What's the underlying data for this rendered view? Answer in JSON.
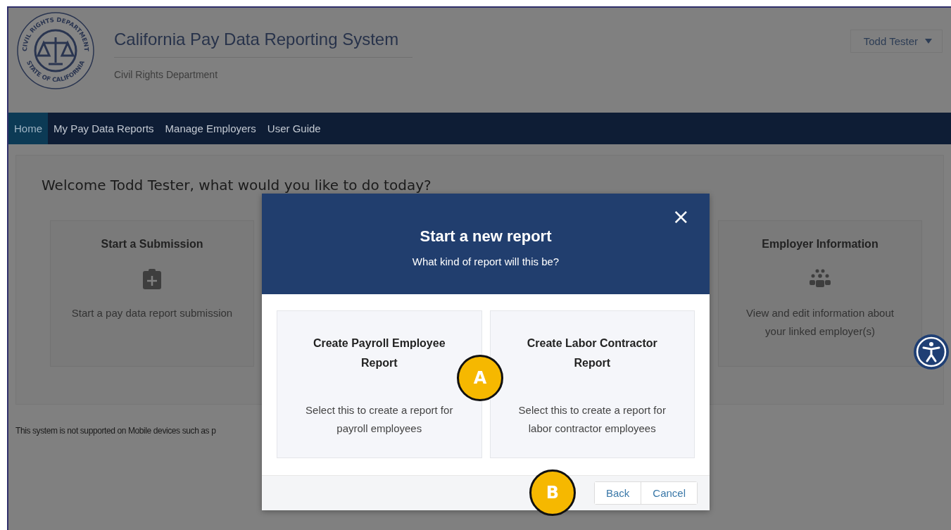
{
  "header": {
    "seal": {
      "top": "CIVIL RIGHTS DEPARTMENT",
      "bottom": "STATE OF CALIFORNIA"
    },
    "title": "California Pay Data Reporting System",
    "subtitle": "Civil Rights Department",
    "user_menu": "Todd Tester"
  },
  "nav": [
    {
      "label": "Home",
      "selected": true
    },
    {
      "label": "My Pay Data Reports",
      "selected": false
    },
    {
      "label": "Manage Employers",
      "selected": false
    },
    {
      "label": "User Guide",
      "selected": false
    }
  ],
  "welcome": "Welcome Todd Tester, what would you like to do today?",
  "cards": [
    {
      "title": "Start a Submission",
      "description": "Start a pay data report submission",
      "kind": "submission"
    },
    {
      "title": "Employer Information",
      "description": "View and edit information about your linked employer(s)",
      "kind": "employer"
    }
  ],
  "notice": "This system is not supported on Mobile devices such as p",
  "modal": {
    "title": "Start a new report",
    "subtitle": "What kind of report will this be?",
    "close": "×",
    "options": [
      {
        "title": "Create Payroll Employee Report",
        "description": "Select this to create a report for payroll employees"
      },
      {
        "title": "Create Labor Contractor Report",
        "description": "Select this to create a report for labor contractor employees"
      }
    ],
    "buttons": [
      "Back",
      "Cancel"
    ]
  },
  "callouts": [
    "A",
    "B"
  ]
}
